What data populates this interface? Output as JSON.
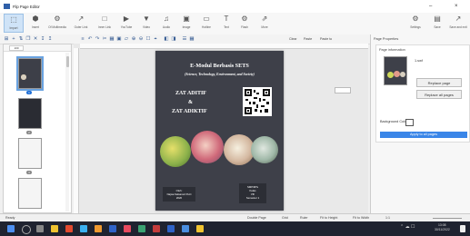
{
  "window": {
    "title": "Flip Page Editor",
    "minimize": "–",
    "close": "×"
  },
  "ribbon": [
    {
      "icon": "⬚",
      "label": "Import"
    },
    {
      "icon": "⬢",
      "label": "Insert"
    },
    {
      "icon": "⚙",
      "label": "Of Multimedia"
    },
    {
      "icon": "↗",
      "label": "Outer Link"
    },
    {
      "icon": "□",
      "label": "Inner Link"
    },
    {
      "icon": "▶",
      "label": "YouTube"
    },
    {
      "icon": "▼",
      "label": "Video"
    },
    {
      "icon": "♫",
      "label": "Audio"
    },
    {
      "icon": "▣",
      "label": "Image"
    },
    {
      "icon": "▭",
      "label": "Hotline"
    },
    {
      "icon": "T",
      "label": "Text"
    },
    {
      "icon": "⚙",
      "label": "Flash"
    },
    {
      "icon": "⇗",
      "label": "More"
    },
    {
      "icon": "⚙",
      "label": "Settings"
    },
    {
      "icon": "▤",
      "label": "Save"
    },
    {
      "icon": "↗",
      "label": "Save and exit"
    }
  ],
  "toolbar2": {
    "clear": "Clear",
    "paste": "Paste",
    "paste_to": "Paste to"
  },
  "thumbs": {
    "zoom": "100",
    "selected_page": "1",
    "pages": [
      "1",
      "2",
      "3"
    ]
  },
  "cover": {
    "title": "E-Modul Berbasis SETS",
    "subtitle": "(Science, Technology, Environment, and Society)",
    "line1": "ZAT ADITIF",
    "amp": "&",
    "line2": "ZAT ADIKTIF",
    "footer_left": "Oleh:\nNajwa Salsanuri Putri\n2020",
    "footer_right": "SMP/MTs\nKelas\nVIII\nSemester 1"
  },
  "properties": {
    "panel_title": "Page Properties",
    "section_title": "Page information",
    "page_number": "1.swf",
    "replace_page": "Replace page",
    "replace_all": "Replace all pages",
    "background_color_label": "Background Color",
    "apply_all": "Apply to all pages"
  },
  "statusbar": {
    "left": "Ready",
    "double_page": "Double Page",
    "grid": "Grid",
    "ruler": "Ruler",
    "fit_height": "Fit to Height",
    "fit_width": "Fit to Width",
    "zoom": "1:1"
  },
  "taskbar": {
    "time": "13:08",
    "date": "30/11/2022",
    "icon_colors": [
      "#4d8ff0",
      "#f0c330",
      "#e34a2f",
      "#3bb0f0",
      "#f09a30",
      "#2f63c8",
      "#e84a5f",
      "#3ba272",
      "#c43c3c",
      "#2f63c8",
      "#f0c330",
      "#4a8ee0"
    ]
  }
}
